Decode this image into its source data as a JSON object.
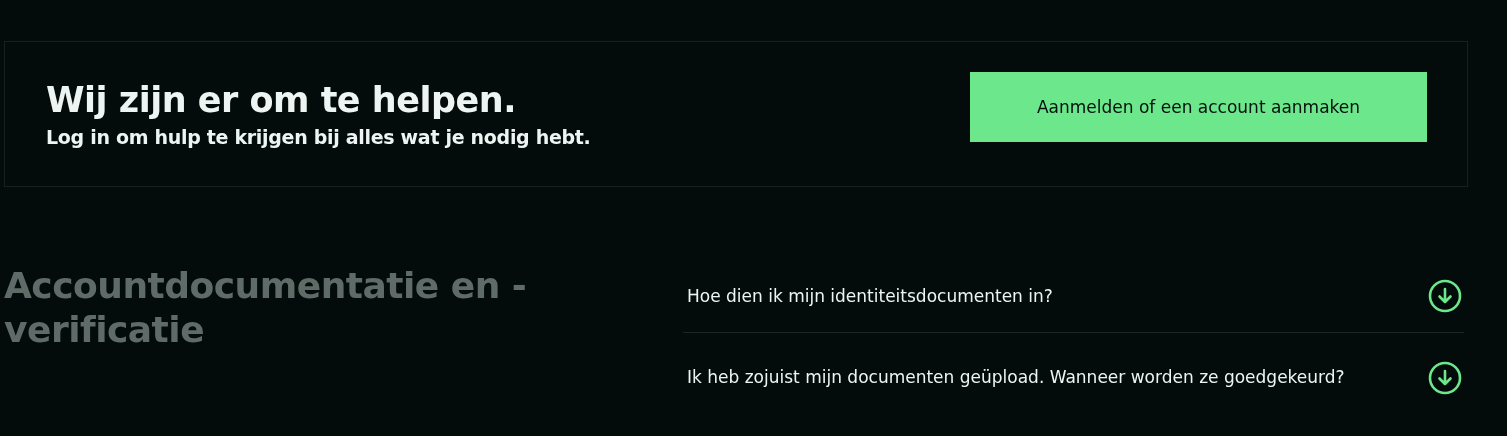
{
  "help_banner": {
    "title": "Wij zijn er om te helpen.",
    "subtitle": "Log in om hulp te krijgen bij alles wat je nodig hebt.",
    "button": "Aanmelden of een account aanmaken"
  },
  "section": {
    "heading": "Accountdocumentatie en -verificatie",
    "faq": [
      {
        "question": "Hoe dien ik mijn identiteitsdocumenten in?",
        "expanded": false
      },
      {
        "question": "Ik heb zojuist mijn documenten geüpload. Wanneer worden ze goedgekeurd?",
        "expanded": false
      }
    ]
  }
}
